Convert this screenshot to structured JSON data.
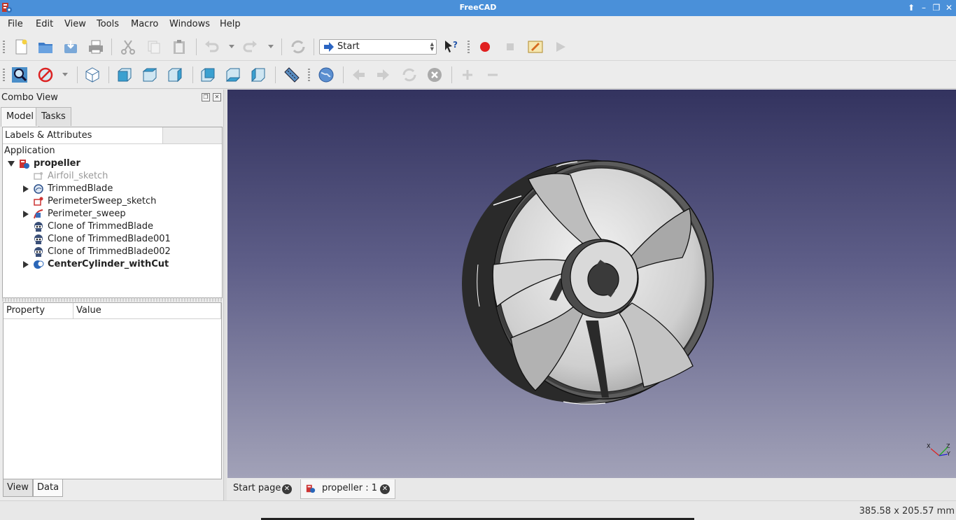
{
  "window": {
    "title": "FreeCAD"
  },
  "menu": [
    "File",
    "Edit",
    "View",
    "Tools",
    "Macro",
    "Windows",
    "Help"
  ],
  "menu_mnemonics": [
    "F",
    "E",
    "V",
    "T",
    "M",
    "W",
    "H"
  ],
  "workbench": {
    "selected": "Start"
  },
  "combo_view": {
    "title": "Combo View",
    "tabs": [
      "Model",
      "Tasks"
    ],
    "tree_header": "Labels & Attributes",
    "root_label": "Application",
    "items": [
      {
        "label": "propeller",
        "icon": "document-icon"
      },
      {
        "label": "Airfoil_sketch",
        "icon": "sketch-icon"
      },
      {
        "label": "TrimmedBlade",
        "icon": "shape-icon"
      },
      {
        "label": "PerimeterSweep_sketch",
        "icon": "sketch-icon"
      },
      {
        "label": "Perimeter_sweep",
        "icon": "sweep-icon"
      },
      {
        "label": "Clone of TrimmedBlade",
        "icon": "clone-icon"
      },
      {
        "label": "Clone of TrimmedBlade001",
        "icon": "clone-icon"
      },
      {
        "label": "Clone of TrimmedBlade002",
        "icon": "clone-icon"
      },
      {
        "label": "CenterCylinder_withCut",
        "icon": "cut-icon"
      }
    ],
    "property_headers": [
      "Property",
      "Value"
    ],
    "bottom_tabs": [
      "View",
      "Data"
    ]
  },
  "document_tabs": [
    "Start page",
    "propeller : 1"
  ],
  "status": {
    "dimensions": "385.58 x 205.57 mm"
  },
  "colors": {
    "titlebar": "#4a90d9",
    "view_top": "#33335f",
    "view_bottom": "#a2a2b8",
    "record": "#e02020"
  }
}
